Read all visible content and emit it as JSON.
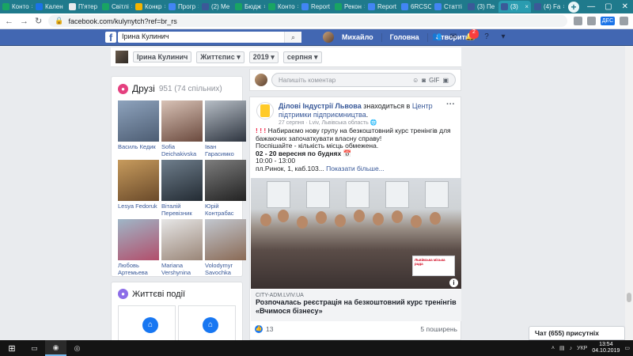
{
  "browser": {
    "tabs": [
      {
        "label": "Конто",
        "color": "#19a463"
      },
      {
        "label": "Кален",
        "color": "#1a73e8"
      },
      {
        "label": "П'ятер",
        "color": "#e8eaed"
      },
      {
        "label": "Світлі",
        "color": "#19a463"
      },
      {
        "label": "Конкр",
        "color": "#f4b400"
      },
      {
        "label": "Прогр",
        "color": "#4285f4"
      },
      {
        "label": "(2) Ме",
        "color": "#3b5998"
      },
      {
        "label": "Бюдж",
        "color": "#19a463"
      },
      {
        "label": "Конто",
        "color": "#19a463"
      },
      {
        "label": "Report",
        "color": "#4285f4"
      },
      {
        "label": "Рекон",
        "color": "#19a463"
      },
      {
        "label": "Report",
        "color": "#4285f4"
      },
      {
        "label": "6RCSC",
        "color": "#4285f4"
      },
      {
        "label": "Статті",
        "color": "#4285f4"
      },
      {
        "label": "(3) Пе",
        "color": "#3b5998"
      },
      {
        "label": "(3)",
        "color": "#3b5998"
      },
      {
        "label": "(4) Fa",
        "color": "#3b5998"
      }
    ],
    "active_tab_index": 15,
    "new_tab_label": "+",
    "window_controls": {
      "minimize": "—",
      "maximize": "▢",
      "close": "✕"
    },
    "url": "facebook.com/kulynytch?ref=br_rs",
    "extension_badge": "ДЕС"
  },
  "facebook": {
    "logo": "f",
    "search_value": "Ірина Кулинич",
    "user_name": "Михайло",
    "nav_home": "Головна",
    "nav_create": "Створити",
    "notification_count": "2",
    "friends_icon": "👥",
    "messenger_icon": "✉",
    "bell_icon": "🔔",
    "help_icon": "?",
    "dropdown_icon": "▾"
  },
  "timeline_nav": {
    "profile_name": "Ірина Кулинич",
    "section": "Життєпис",
    "year": "2019",
    "month": "серпня"
  },
  "friends": {
    "title": "Друзі",
    "count": "951 (74 спільних)",
    "people": [
      {
        "name": "Василь Кедик",
        "c1": "#8ea3bd",
        "c2": "#4d5d73"
      },
      {
        "name": "Sofia Deichakivska",
        "c1": "#d8c2b6",
        "c2": "#6b4a3e"
      },
      {
        "name": "Іван Гарасимко",
        "c1": "#b7bec6",
        "c2": "#2e3540"
      },
      {
        "name": "Lesya Fedoruk",
        "c1": "#c79b5d",
        "c2": "#6a4a2a"
      },
      {
        "name": "Віталій Перевізник",
        "c1": "#6f7e8c",
        "c2": "#232b33"
      },
      {
        "name": "Юрій Контрабас",
        "c1": "#7d7d7d",
        "c2": "#222222"
      },
      {
        "name": "Любовь Артемьева",
        "c1": "#9fb6c7",
        "c2": "#b24e6b"
      },
      {
        "name": "Mariana Vershynina",
        "c1": "#e6e6e6",
        "c2": "#9a8678"
      },
      {
        "name": "Volodymyr Savochka",
        "c1": "#c2c7cf",
        "c2": "#8a6a55"
      }
    ]
  },
  "life_events": {
    "title": "Життєві події"
  },
  "comment_box": {
    "placeholder": "Напишіть коментар",
    "icons": [
      "☺",
      "◙",
      "GIF",
      "▣"
    ]
  },
  "post": {
    "author": "Ділові Індустрії Львова",
    "connector": "знаходиться в",
    "place": "Центр підтримки підприємництва",
    "time": "27 серпня · Lviv, Львівська область",
    "line1": "Набираємо нову групу на безкоштовний курс тренінгів для бажаючих започаткувати власну справу!",
    "line2": "Поспішайте - кількість місць обмежена.",
    "dates": "02 - 20 вересня по буднях 📅",
    "time_range": "10:00 - 13:00",
    "address": "пл.Ринок, 1, каб.103...",
    "show_more": "Показати більше...",
    "link_domain": "CITY-ADM.LVIV.UA",
    "link_title": "Розпочалась реєстрація на безкоштовний курс тренінгів «Вчимося бізнесу»",
    "sticker_text": "Львівська міська рада",
    "likes": "13",
    "shares": "5 поширень"
  },
  "chat": {
    "label": "Чат (655) присутніх"
  },
  "taskbar": {
    "start_icon": "⊞",
    "apps": [
      "▭",
      "◉",
      "◎"
    ],
    "language": "УКР",
    "time": "13:54",
    "date": "04.10.2019"
  },
  "colors": {
    "fb_blue": "#4267b2",
    "link": "#385898",
    "tab_bar": "#1f7a8c"
  }
}
